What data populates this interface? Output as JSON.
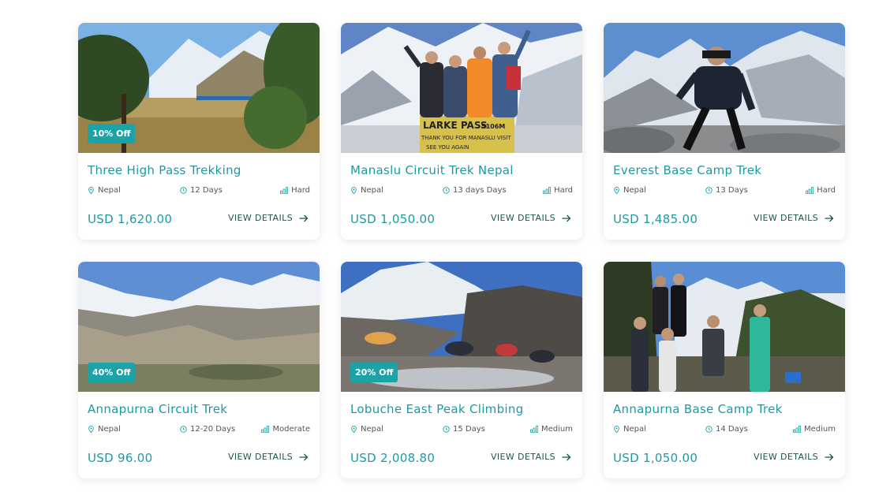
{
  "cards": [
    {
      "title": "Three High Pass Trekking",
      "badge": "10% Off",
      "location": "Nepal",
      "duration": "12 Days",
      "difficulty": "Hard",
      "price": "USD 1,620.00",
      "cta": "VIEW DETAILS"
    },
    {
      "title": "Manaslu Circuit Trek Nepal",
      "badge": "",
      "location": "Nepal",
      "duration": "13 days Days",
      "difficulty": "Hard",
      "price": "USD 1,050.00",
      "cta": "VIEW DETAILS"
    },
    {
      "title": "Everest Base Camp Trek",
      "badge": "",
      "location": "Nepal",
      "duration": "13 Days",
      "difficulty": "Hard",
      "price": "USD 1,485.00",
      "cta": "VIEW DETAILS"
    },
    {
      "title": "Annapurna Circuit Trek",
      "badge": "40% Off",
      "location": "Nepal",
      "duration": "12-20 Days",
      "difficulty": "Moderate",
      "price": "USD 96.00",
      "cta": "VIEW DETAILS"
    },
    {
      "title": "Lobuche East Peak Climbing",
      "badge": "20% Off",
      "location": "Nepal",
      "duration": "15 Days",
      "difficulty": "Medium",
      "price": "USD 2,008.80",
      "cta": "VIEW DETAILS"
    },
    {
      "title": "Annapurna Base Camp Trek",
      "badge": "",
      "location": "Nepal",
      "duration": "14 Days",
      "difficulty": "Medium",
      "price": "USD 1,050.00",
      "cta": "VIEW DETAILS"
    }
  ],
  "photo_signs": {
    "card_1": [
      "LARKE PASS",
      "5106M",
      "THANK YOU FOR MANASLU VISIT",
      "SEE YOU AGAIN"
    ]
  },
  "colors": {
    "accent": "#1ba3a8",
    "title": "#1c9aa3",
    "cta": "#1c5a3a"
  },
  "icons": {
    "location": "map-pin-icon",
    "duration": "clock-icon",
    "difficulty": "bar-chart-icon",
    "cta": "arrow-right-icon"
  }
}
